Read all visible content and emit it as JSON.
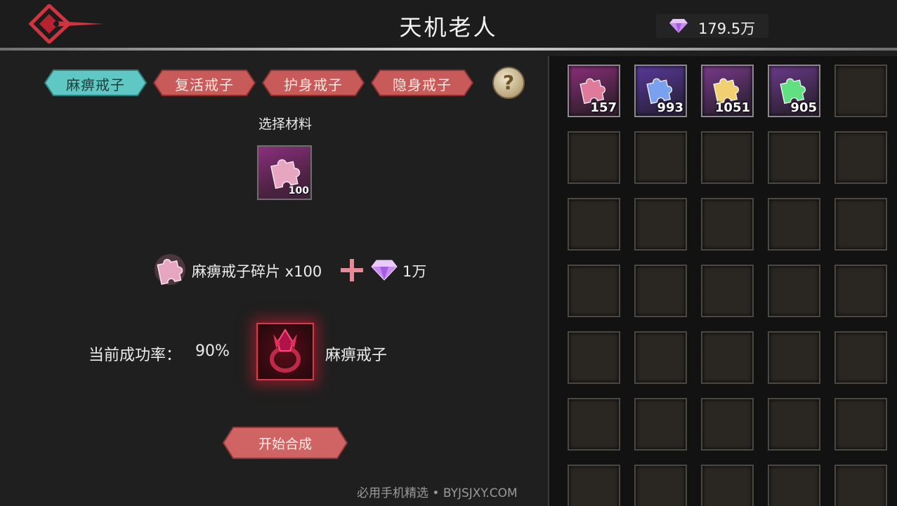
{
  "header": {
    "title": "天机老人"
  },
  "currency": {
    "icon": "diamond-icon",
    "amount": "179.5万",
    "color": "#c98cf0"
  },
  "tabs": [
    {
      "label": "麻痹戒子",
      "active": true,
      "color": "#5fc8c4"
    },
    {
      "label": "复活戒子",
      "active": false,
      "color": "#d86a6a"
    },
    {
      "label": "护身戒子",
      "active": false,
      "color": "#d86a6a"
    },
    {
      "label": "隐身戒子",
      "active": false,
      "color": "#d86a6a"
    }
  ],
  "help_icon": "question-icon",
  "material": {
    "label": "选择材料",
    "count": "100",
    "icon": "puzzle-piece-icon"
  },
  "recipe": {
    "item_name": "麻痹戒子碎片 x100",
    "plus": "plus-icon",
    "cost": "1万"
  },
  "result": {
    "rate_label": "当前成功率：",
    "rate_value": "90%",
    "item_name": "麻痹戒子",
    "icon": "ring-icon"
  },
  "craft_button": {
    "label": "开始合成"
  },
  "inventory": {
    "items": [
      {
        "count": "157",
        "color": "#e07a9a",
        "bg": "#8a2f7a"
      },
      {
        "count": "993",
        "color": "#7aa0f0",
        "bg": "#5a3a9a"
      },
      {
        "count": "1051",
        "color": "#f0d070",
        "bg": "#7a3a8a"
      },
      {
        "count": "905",
        "color": "#60e080",
        "bg": "#6a3a8a"
      }
    ]
  },
  "watermark": "必用手机精选 • BYJSJXY.COM"
}
